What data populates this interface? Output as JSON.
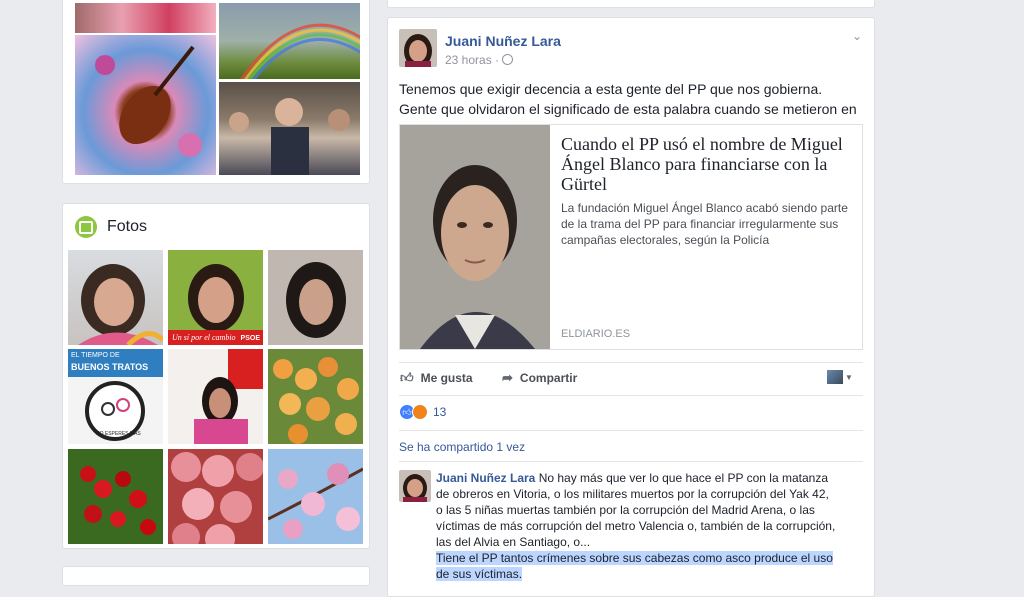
{
  "photos": {
    "title": "Fotos",
    "thumb_text": {
      "banner": "Un sí por el cambio",
      "psoe": "PSOE",
      "tiempo": "EL TIEMPO DE",
      "buenos": "BUENOS TRATOS",
      "no_esperes": "NO ESPERES MÁS"
    }
  },
  "post": {
    "author": "Juani Nuñez Lara",
    "time": "23 horas",
    "text": "Tenemos que exigir decencia a esta gente del PP que nos gobierna. Gente que olvidaron el significado de esta palabra cuando se metieron en política.",
    "link": {
      "title": "Cuando el PP usó el nombre de Miguel Ángel Blanco para financiarse con la Gürtel",
      "description": "La fundación Miguel Ángel Blanco acabó siendo parte de la trama del PP para financiar irregularmente sus campañas electorales, según la Policía",
      "domain": "ELDIARIO.ES"
    },
    "actions": {
      "like": "Me gusta",
      "share": "Compartir"
    },
    "reactions_count": "13",
    "shared": "Se ha compartido 1 vez",
    "comment": {
      "author": "Juani Nuñez Lara",
      "text": "No hay más que ver lo que hace el PP con la matanza de obreros en Vitoria, o los militares muertos por la corrupción del Yak 42, o las 5 niñas muertas también por la corrupción del Madrid Arena, o las víctimas de más corrupción del metro Valencia o, también de la corrupción, las del Alvia en Santiago, o...",
      "highlighted": "Tiene el PP tantos crímenes sobre sus cabezas como asco produce el uso de sus víctimas."
    }
  },
  "colors": {
    "link": "#365899",
    "background": "#e9ebee",
    "highlight": "#bcd6ff"
  }
}
